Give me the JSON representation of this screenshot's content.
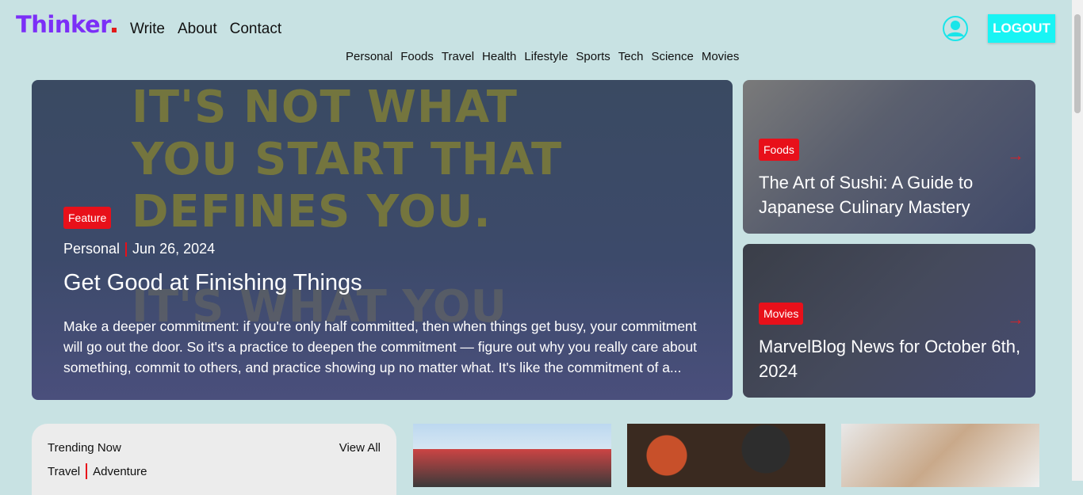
{
  "header": {
    "logo": "Thinker",
    "nav": [
      "Write",
      "About",
      "Contact"
    ],
    "categories": [
      "Personal",
      "Foods",
      "Travel",
      "Health",
      "Lifestyle",
      "Sports",
      "Tech",
      "Science",
      "Movies"
    ],
    "logout_label": "LOGOUT"
  },
  "hero": {
    "quote_line1": "IT'S NOT WHAT",
    "quote_line2": "YOU START THAT",
    "quote_line3": "DEFINES YOU.",
    "quote_line4": "IT'S WHAT YOU",
    "badge": "Feature",
    "category": "Personal",
    "date": "Jun 26, 2024",
    "title": "Get Good at Finishing Things",
    "description": "Make a deeper commitment: if you're only half committed, then when things get busy, your commitment will go out the door. So it's a practice to deepen the commitment — figure out why you really care about something, commit to others, and practice showing up no matter what. It's like the commitment of a..."
  },
  "side_cards": [
    {
      "badge": "Foods",
      "title": "The Art of Sushi: A Guide to Japanese Culinary Mastery"
    },
    {
      "badge": "Movies",
      "title": "MarvelBlog News for October 6th, 2024"
    }
  ],
  "trending": {
    "heading": "Trending Now",
    "view_all": "View All",
    "tags": [
      "Travel",
      "Adventure"
    ]
  },
  "colors": {
    "background": "#c8e2e3",
    "brand": "#7b2ff7",
    "accent_red": "#e8101a",
    "logout_bg": "#19f4f4"
  }
}
